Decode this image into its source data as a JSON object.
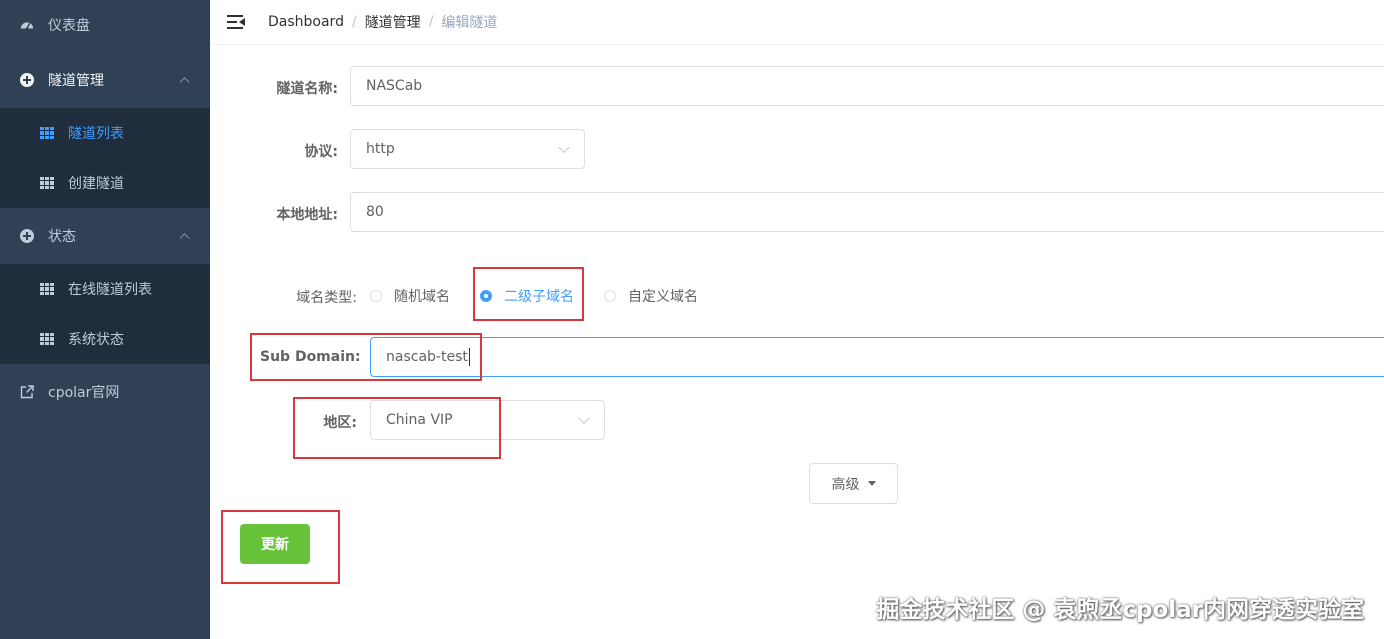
{
  "sidebar": {
    "dashboard": "仪表盘",
    "tunnel_mgmt": "隧道管理",
    "tunnel_list": "隧道列表",
    "create_tunnel": "创建隧道",
    "status": "状态",
    "online_tunnels": "在线隧道列表",
    "system_status": "系统状态",
    "cpolar_site": "cpolar官网"
  },
  "breadcrumb": {
    "home": "Dashboard",
    "section": "隧道管理",
    "current": "编辑隧道",
    "separator": "/"
  },
  "form": {
    "tunnel_name_label": "隧道名称:",
    "tunnel_name_value": "NASCab",
    "protocol_label": "协议:",
    "protocol_value": "http",
    "local_addr_label": "本地地址:",
    "local_addr_value": "80",
    "domain_type_label": "域名类型:",
    "domain_type_options": [
      "随机域名",
      "二级子域名",
      "自定义域名"
    ],
    "domain_type_selected": "二级子域名",
    "subdomain_label": "Sub Domain:",
    "subdomain_value": "nascab-test",
    "region_label": "地区:",
    "region_value": "China VIP",
    "advanced_label": "高级",
    "update_label": "更新"
  },
  "watermark": "掘金技术社区 @ 袁煦丞cpolar内网穿透实验室",
  "colors": {
    "sidebar_bg": "#304156",
    "submenu_bg": "#1f2d3d",
    "active": "#409eff",
    "success": "#67c23a",
    "highlight_border": "#d9363e"
  }
}
